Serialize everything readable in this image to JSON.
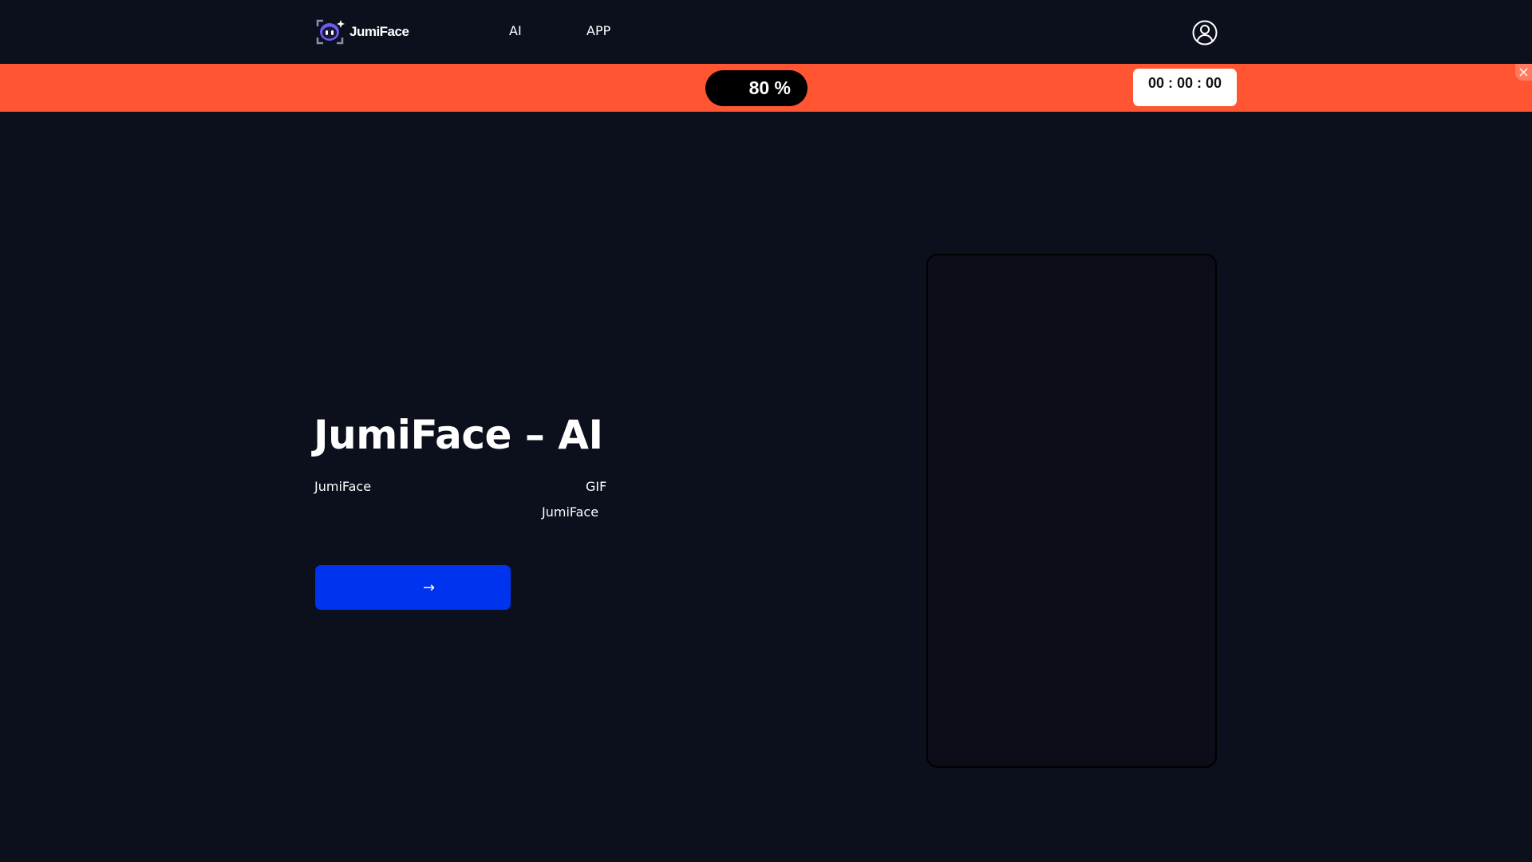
{
  "header": {
    "logo_text": "JumiFace",
    "nav": [
      {
        "label": "AI"
      },
      {
        "label": "APP"
      }
    ],
    "user_icon": "user-circle-icon"
  },
  "promo": {
    "discount": "80 %",
    "timer": "00 : 00 :  00",
    "close_icon": "close-icon",
    "background": "#ff5533"
  },
  "hero": {
    "title": "JumiFace – AI",
    "lines": [
      "JumiFace",
      "GIF",
      "JumiFace"
    ],
    "cta_arrow": "→",
    "cta_color": "#0033ee"
  },
  "colors": {
    "page_bg": "#0c0f1c",
    "accent": "#0033ee",
    "banner": "#ff5533"
  }
}
